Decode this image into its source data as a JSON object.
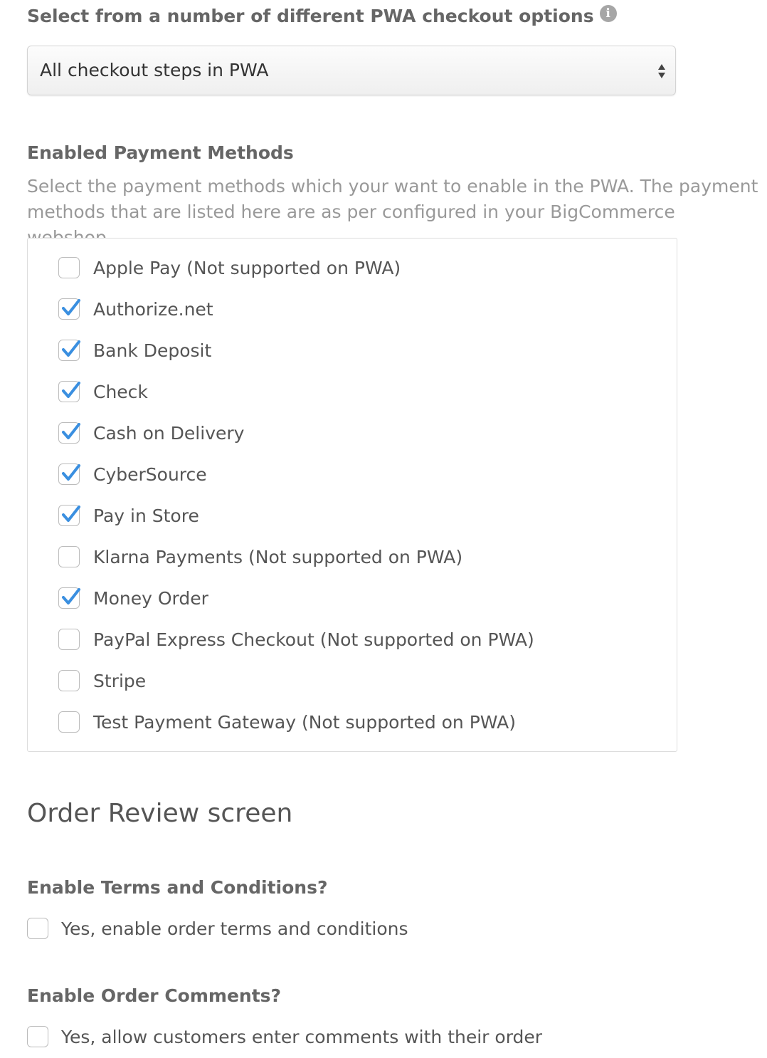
{
  "checkout": {
    "label": "Select from a number of different PWA checkout options",
    "info_icon": "i",
    "selected_option": "All checkout steps in PWA"
  },
  "payment": {
    "title": "Enabled Payment Methods",
    "help": "Select the payment methods which your want to enable in the PWA. The payment methods that are listed here are as per configured in your BigCommerce webshop.",
    "methods": [
      {
        "label": "Apple Pay (Not supported on PWA)",
        "checked": false
      },
      {
        "label": "Authorize.net",
        "checked": true
      },
      {
        "label": "Bank Deposit",
        "checked": true
      },
      {
        "label": "Check",
        "checked": true
      },
      {
        "label": "Cash on Delivery",
        "checked": true
      },
      {
        "label": "CyberSource",
        "checked": true
      },
      {
        "label": "Pay in Store",
        "checked": true
      },
      {
        "label": "Klarna Payments (Not supported on PWA)",
        "checked": false
      },
      {
        "label": "Money Order",
        "checked": true
      },
      {
        "label": "PayPal Express Checkout (Not supported on PWA)",
        "checked": false
      },
      {
        "label": "Stripe",
        "checked": false
      },
      {
        "label": "Test Payment Gateway (Not supported on PWA)",
        "checked": false
      }
    ]
  },
  "order_review": {
    "heading": "Order Review screen",
    "terms": {
      "title": "Enable Terms and Conditions?",
      "option_label": "Yes, enable order terms and conditions",
      "checked": false
    },
    "comments": {
      "title": "Enable Order Comments?",
      "option_label": "Yes, allow customers enter comments with their order",
      "checked": false
    }
  },
  "colors": {
    "check_mark": "#3a8fe0",
    "label_text": "#555555",
    "help_text": "#999999"
  }
}
